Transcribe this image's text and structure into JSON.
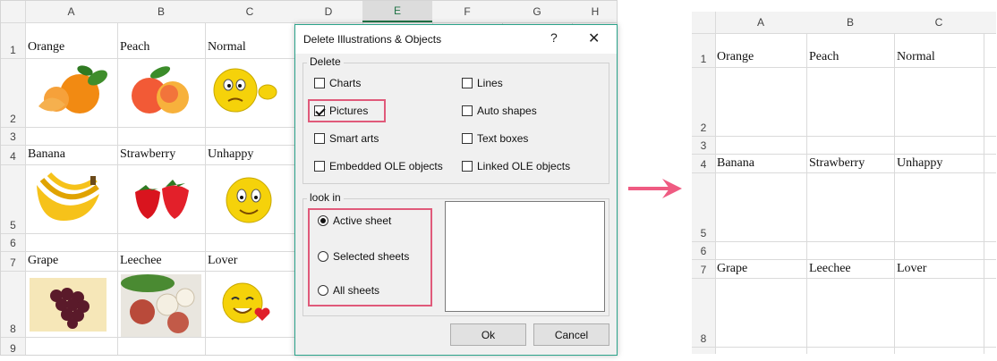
{
  "left_sheet": {
    "columns": [
      "A",
      "B",
      "C",
      "D",
      "E",
      "F",
      "G",
      "H"
    ],
    "selected_column": "E",
    "rows": [
      "1",
      "2",
      "3",
      "4",
      "5",
      "6",
      "7",
      "8",
      "9"
    ],
    "cells": {
      "A1": "Orange",
      "B1": "Peach",
      "C1": "Normal",
      "A4": "Banana",
      "B4": "Strawberry",
      "C4": "Unhappy",
      "A7": "Grape",
      "B7": "Leechee",
      "C7": "Lover"
    },
    "pictures": [
      "orange",
      "peach",
      "normal-smiley",
      "banana",
      "strawberry",
      "unhappy-smiley",
      "grape",
      "leechee",
      "lover-smiley"
    ]
  },
  "dialog": {
    "title": "Delete Illustrations & Objects",
    "help": "?",
    "close": "✕",
    "delete_group": {
      "label": "Delete",
      "options": [
        {
          "label": "Charts",
          "checked": false
        },
        {
          "label": "Lines",
          "checked": false
        },
        {
          "label": "Pictures",
          "checked": true
        },
        {
          "label": "Auto shapes",
          "checked": false
        },
        {
          "label": "Smart arts",
          "checked": false
        },
        {
          "label": "Text boxes",
          "checked": false
        },
        {
          "label": "Embedded OLE objects",
          "checked": false
        },
        {
          "label": "Linked OLE objects",
          "checked": false
        }
      ]
    },
    "lookin_group": {
      "label": "look in",
      "options": [
        {
          "label": "Active sheet",
          "selected": true
        },
        {
          "label": "Selected sheets",
          "selected": false
        },
        {
          "label": "All sheets",
          "selected": false
        }
      ]
    },
    "ok_label": "Ok",
    "cancel_label": "Cancel",
    "highlight_color": "#e05a7a"
  },
  "arrow_color": "#ef5b82",
  "right_sheet": {
    "columns": [
      "A",
      "B",
      "C"
    ],
    "rows": [
      "1",
      "2",
      "3",
      "4",
      "5",
      "6",
      "7",
      "8"
    ],
    "cells": {
      "A1": "Orange",
      "B1": "Peach",
      "C1": "Normal",
      "A4": "Banana",
      "B4": "Strawberry",
      "C4": "Unhappy",
      "A7": "Grape",
      "B7": "Leechee",
      "C7": "Lover"
    }
  }
}
